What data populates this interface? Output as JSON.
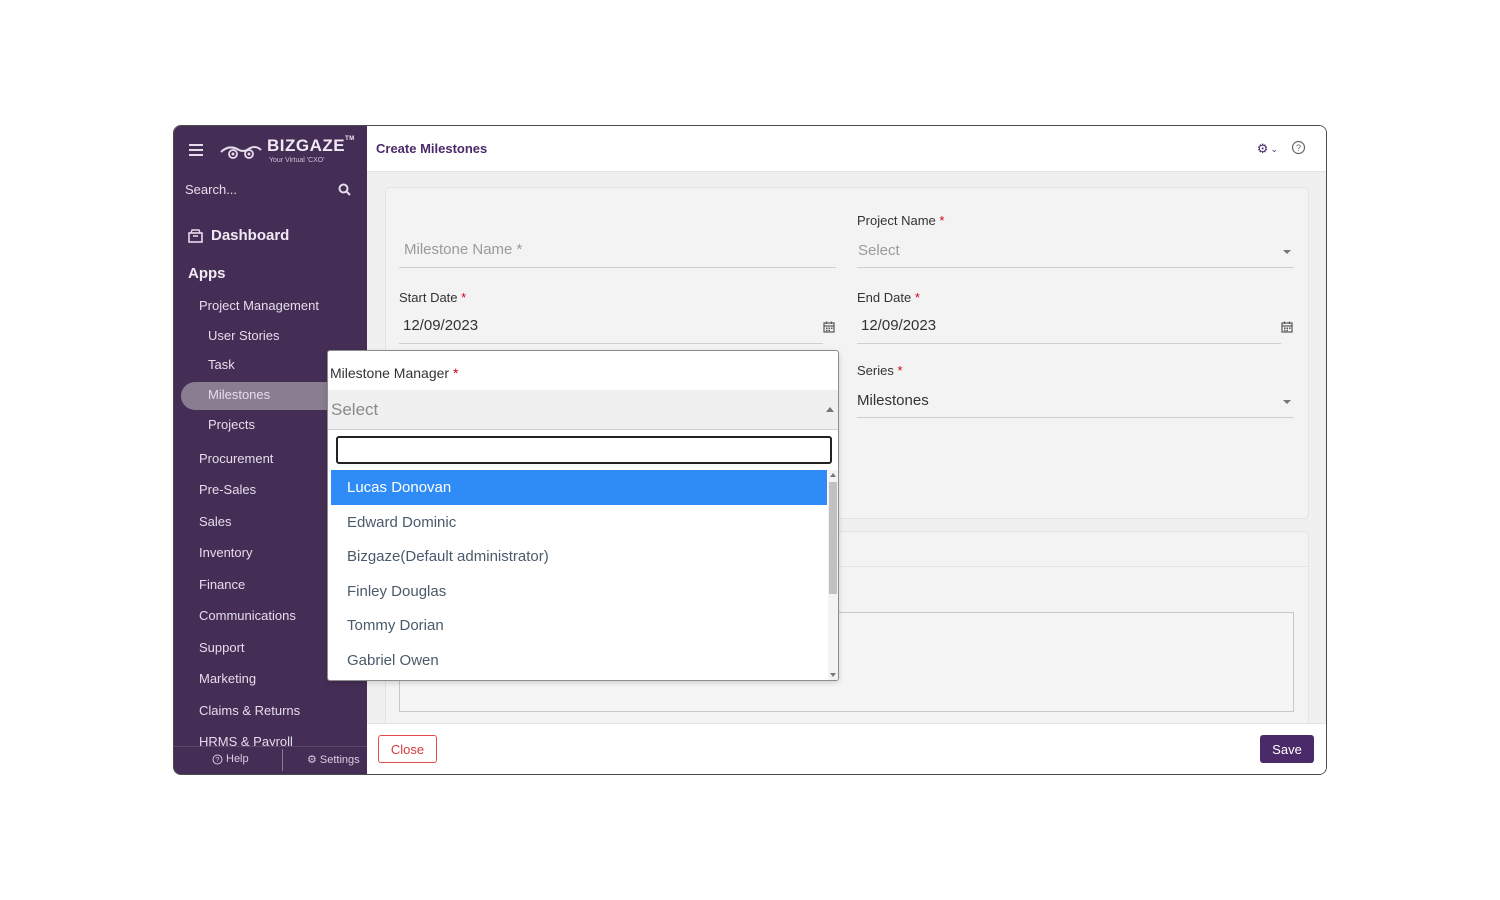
{
  "brand": {
    "name": "BIZGAZE",
    "tm": "TM",
    "tagline": "Your Virtual 'CXO'"
  },
  "sidebar": {
    "search_placeholder": "Search...",
    "dashboard": "Dashboard",
    "apps": "Apps",
    "items": [
      "Project Management",
      "User Stories",
      "Task",
      "Milestones",
      "Projects",
      "Procurement",
      "Pre-Sales",
      "Sales",
      "Inventory",
      "Finance",
      "Communications",
      "Support",
      "Marketing",
      "Claims & Returns",
      "HRMS & Payroll"
    ],
    "active_item": "Milestones",
    "help": "Help",
    "settings": "Settings"
  },
  "header": {
    "title": "Create Milestones"
  },
  "form": {
    "milestone_name_placeholder": "Milestone Name *",
    "project_name_label": "Project Name",
    "project_name_placeholder": "Select",
    "start_date_label": "Start Date",
    "start_date_value": "12/09/2023",
    "end_date_label": "End Date",
    "end_date_value": "12/09/2023",
    "series_label": "Series",
    "series_value": "Milestones",
    "required_mark": "*"
  },
  "dropdown": {
    "label": "Milestone Manager",
    "placeholder": "Select",
    "search_value": "",
    "options": [
      "Lucas Donovan",
      "Edward Dominic",
      "Bizgaze(Default administrator)",
      "Finley Douglas",
      "Tommy Dorian",
      "Gabriel Owen"
    ],
    "highlighted": "Lucas Donovan"
  },
  "footer": {
    "close_label": "Close",
    "save_label": "Save"
  },
  "colors": {
    "sidebar": "#452e55",
    "accent": "#4b2a6a",
    "highlight": "#2f8cf6",
    "danger": "#d23c3c"
  }
}
